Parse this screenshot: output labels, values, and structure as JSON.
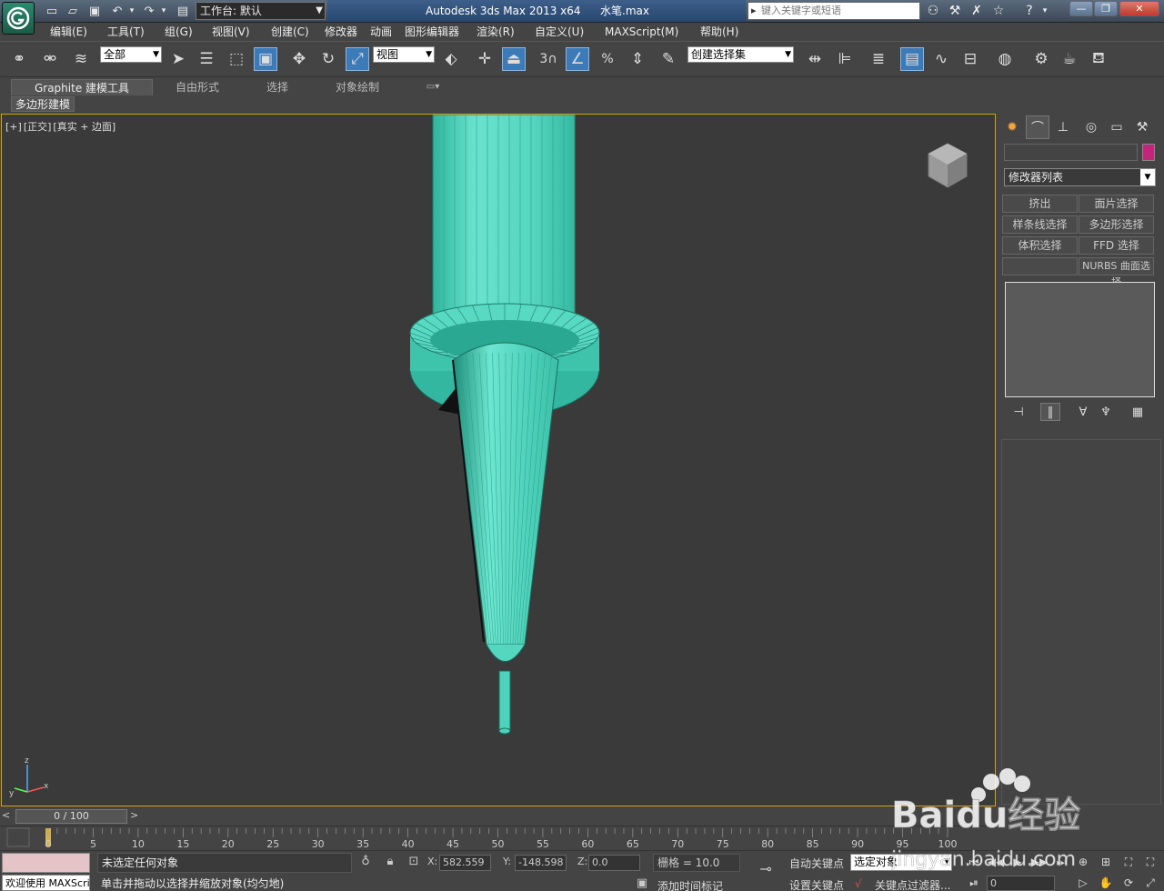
{
  "window": {
    "title_app": "Autodesk 3ds Max  2013 x64",
    "title_file": "水笔.max",
    "workspace": "工作台: 默认",
    "search_placeholder": "键入关键字或短语"
  },
  "menu": [
    "编辑(E)",
    "工具(T)",
    "组(G)",
    "视图(V)",
    "创建(C)",
    "修改器",
    "动画",
    "图形编辑器",
    "渲染(R)",
    "自定义(U)",
    "MAXScript(M)",
    "帮助(H)"
  ],
  "toolbar": {
    "selection_filter": "全部",
    "ref_coord": "视图",
    "snap_3": "3",
    "named_selection": "创建选择集"
  },
  "ribbon": {
    "tabs": [
      "Graphite 建模工具",
      "自由形式",
      "选择",
      "对象绘制"
    ],
    "subtab": "多边形建模"
  },
  "viewport": {
    "label_parts": [
      "[+]",
      "[正交]",
      "[真实 + 边面]"
    ],
    "axis_labels": {
      "x": "x",
      "y": "y",
      "z": "z"
    }
  },
  "command_panel": {
    "modifier_list": "修改器列表",
    "modifier_buttons": [
      "挤出",
      "面片选择",
      "样条线选择",
      "多边形选择",
      "体积选择",
      "FFD 选择",
      "",
      "NURBS 曲面选择"
    ]
  },
  "timeline": {
    "range": "0 / 100",
    "ticks": [
      "0",
      "5",
      "10",
      "15",
      "20",
      "25",
      "30",
      "35",
      "40",
      "45",
      "50",
      "55",
      "60",
      "65",
      "70",
      "75",
      "80",
      "85",
      "90",
      "95",
      "100"
    ]
  },
  "status": {
    "maxscript": "欢迎使用 MAXScri",
    "selection": "未选定任何对象",
    "prompt": "单击并拖动以选择并缩放对象(均匀地)",
    "x_label": "X:",
    "x": "582.559",
    "y_label": "Y:",
    "y": "-148.598",
    "z_label": "Z:",
    "z": "0.0",
    "grid": "栅格 = 10.0",
    "add_time_tag": "添加时间标记",
    "auto_key": "自动关键点",
    "set_key": "设置关键点",
    "key_mode": "选定对象",
    "key_filters": "关键点过滤器...",
    "frame": "0"
  },
  "colors": {
    "model": "#5fd9c3",
    "model_dark": "#2aa890",
    "viewport_border": "#d0a020",
    "swatch": "#c2267a"
  },
  "watermark": {
    "text": "Baidu经验",
    "url": "jingyan.baidu.com"
  }
}
